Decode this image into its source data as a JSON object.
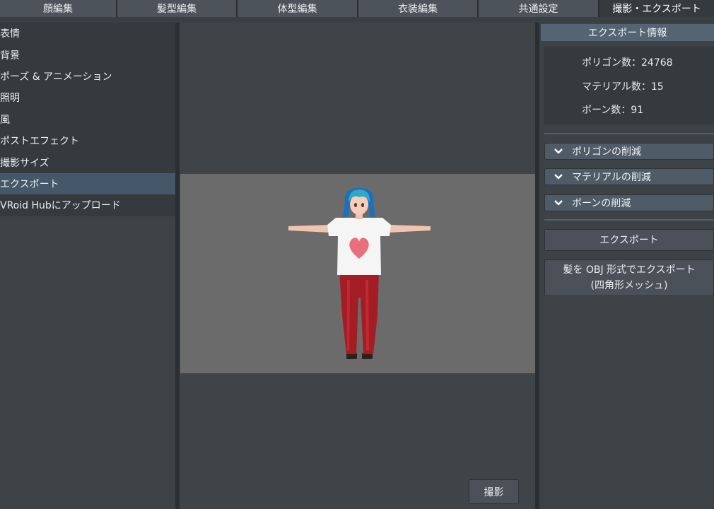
{
  "tabs": [
    {
      "label": "顔編集"
    },
    {
      "label": "髪型編集"
    },
    {
      "label": "体型編集"
    },
    {
      "label": "衣装編集"
    },
    {
      "label": "共通設定"
    },
    {
      "label": "撮影・エクスポート"
    }
  ],
  "sidebar": {
    "items": [
      {
        "label": "表情"
      },
      {
        "label": "背景"
      },
      {
        "label": "ポーズ & アニメーション"
      },
      {
        "label": "照明"
      },
      {
        "label": "風"
      },
      {
        "label": "ポストエフェクト"
      },
      {
        "label": "撮影サイズ"
      },
      {
        "label": "エクスポート"
      },
      {
        "label": "VRoid Hubにアップロード"
      }
    ]
  },
  "viewport": {
    "capture_label": "撮影"
  },
  "export_panel": {
    "header": "エクスポート情報",
    "polygon_count": "ポリゴン数：24768",
    "material_count": "マテリアル数：15",
    "bone_count": "ボーン数：91",
    "sections": [
      {
        "label": "ポリゴンの削減"
      },
      {
        "label": "マテリアルの削減"
      },
      {
        "label": "ボーンの削減"
      }
    ],
    "export_label": "エクスポート",
    "hair_export_line1": "髪を OBJ 形式でエクスポート",
    "hair_export_line2": "(四角形メッシュ)"
  },
  "colors": {
    "active_tab": "#353a3f",
    "active_sidebar": "#44586a",
    "header": "#546472",
    "canvas_bg": "#6b6b6b"
  }
}
